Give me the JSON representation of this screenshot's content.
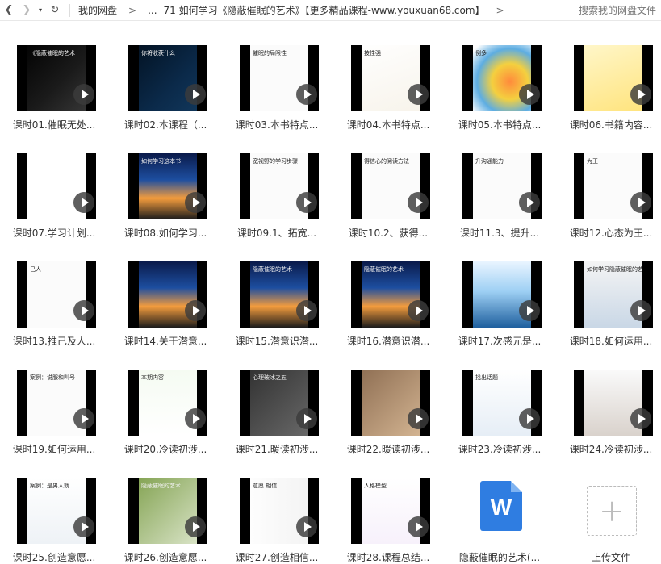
{
  "toolbar": {
    "back": "❮",
    "forward": "❯",
    "dropdown": "▾",
    "refresh": "↻",
    "crumb_root": "我的网盘",
    "crumb_arrow": ">",
    "crumb_ellipsis": "...",
    "crumb_current": "71 如何学习《隐蔽催眠的艺术》【更多精品课程-www.youxuan68.com】",
    "crumb_end_arrow": ">",
    "search_placeholder": "搜索我的网盘文件"
  },
  "files": [
    {
      "label": "课时01.催眠无处...",
      "type": "video",
      "theme": "dark",
      "caption": "《隐蔽催眠的艺术"
    },
    {
      "label": "课时02.本课程（...",
      "type": "video",
      "theme": "dark-blue",
      "caption": "你将收获什么"
    },
    {
      "label": "课时03.本书特点...",
      "type": "video",
      "theme": "white",
      "caption": "催眠的局限性"
    },
    {
      "label": "课时04.本书特点...",
      "type": "video",
      "theme": "hands",
      "caption": "技性强"
    },
    {
      "label": "课时05.本书特点...",
      "type": "video",
      "theme": "colorful",
      "caption": "例多"
    },
    {
      "label": "课时06.书籍内容...",
      "type": "video",
      "theme": "yellow",
      "caption": ""
    },
    {
      "label": "课时07.学习计划...",
      "type": "video",
      "theme": "person",
      "caption": ""
    },
    {
      "label": "课时08.如何学习...",
      "type": "video",
      "theme": "sunset",
      "caption": "如何学习这本书"
    },
    {
      "label": "课时09.1、拓宽...",
      "type": "video",
      "theme": "white",
      "caption": "宽视野的学习步骤"
    },
    {
      "label": "课时10.2、获得...",
      "type": "video",
      "theme": "white",
      "caption": "得信心的阅读方法"
    },
    {
      "label": "课时11.3、提升...",
      "type": "video",
      "theme": "white",
      "caption": "升沟通能力"
    },
    {
      "label": "课时12.心态为王...",
      "type": "video",
      "theme": "white",
      "caption": "为王"
    },
    {
      "label": "课时13.推己及人...",
      "type": "video",
      "theme": "white",
      "caption": "己人"
    },
    {
      "label": "课时14.关于潜意...",
      "type": "video",
      "theme": "sunset",
      "caption": ""
    },
    {
      "label": "课时15.潜意识潜...",
      "type": "video",
      "theme": "sunset",
      "caption": "隐蔽催眠的艺术"
    },
    {
      "label": "课时16.潜意识潜...",
      "type": "video",
      "theme": "sunset",
      "caption": "隐蔽催眠的艺术"
    },
    {
      "label": "课时17.次感元是...",
      "type": "video",
      "theme": "iceberg",
      "caption": ""
    },
    {
      "label": "课时18.如何运用...",
      "type": "video",
      "theme": "crowd",
      "caption": "如何学习隐蔽催眠的艺术?"
    },
    {
      "label": "课时19.如何运用...",
      "type": "video",
      "theme": "white",
      "caption": "案例：说服和叫号"
    },
    {
      "label": "课时20.冷读初涉...",
      "type": "video",
      "theme": "green",
      "caption": "本期内容"
    },
    {
      "label": "课时21.暖读初涉...",
      "type": "video",
      "theme": "couple",
      "caption": "心理破冰之五"
    },
    {
      "label": "课时22.暖读初涉...",
      "type": "video",
      "theme": "woman",
      "caption": ""
    },
    {
      "label": "课时23.冷读初涉...",
      "type": "video",
      "theme": "lens",
      "caption": "找出话题"
    },
    {
      "label": "课时24.冷读初涉...",
      "type": "video",
      "theme": "girl",
      "caption": ""
    },
    {
      "label": "课时25.创造意愿...",
      "type": "video",
      "theme": "man",
      "caption": "案例：是男人就..."
    },
    {
      "label": "课时26.创造意愿...",
      "type": "video",
      "theme": "bride",
      "caption": "隐蔽催眠的艺术"
    },
    {
      "label": "课时27.创造相信...",
      "type": "video",
      "theme": "arrow",
      "caption": "意愿 相信"
    },
    {
      "label": "课时28.课程总结...",
      "type": "video",
      "theme": "em",
      "caption": "人格模型"
    },
    {
      "label": "隐蔽催眠的艺术(...",
      "type": "doc",
      "glyph": "W"
    },
    {
      "label": "上传文件",
      "type": "upload",
      "glyph": "+"
    }
  ],
  "colors": {
    "doc_blue": "#2f7de1"
  }
}
